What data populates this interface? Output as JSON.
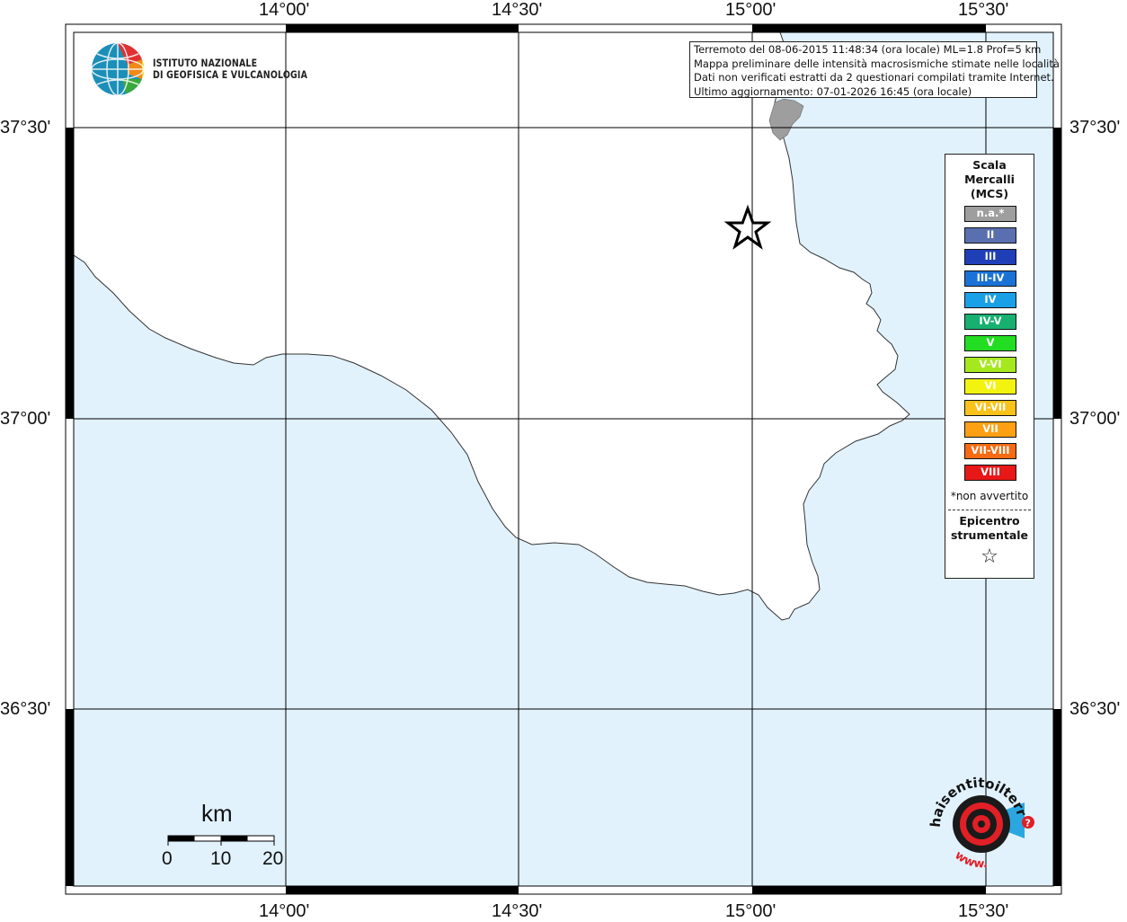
{
  "colors": {
    "sea": "#e1f2fd",
    "land": "#ffffff",
    "urban": "#9e9e9e",
    "frame": "#000000"
  },
  "axes": {
    "top_longitudes": [
      "14°00'",
      "14°30'",
      "15°00'",
      "15°30'"
    ],
    "bottom_longitudes": [
      "14°00'",
      "14°30'",
      "15°00'",
      "15°30'"
    ],
    "left_latitudes": [
      "37°30'",
      "37°00'",
      "36°30'"
    ],
    "right_latitudes": [
      "37°30'",
      "37°00'",
      "36°30'"
    ]
  },
  "header": {
    "org_line1": "ISTITUTO NAZIONALE",
    "org_line2": "DI GEOFISICA E VULCANOLOGIA",
    "logo_icon": "ingv-globe-logo-icon"
  },
  "info": {
    "line1": "Terremoto del 08-06-2015 11:48:34 (ora locale) ML=1.8 Prof=5 km",
    "line2": "Mappa preliminare delle intensità macrosismiche stimate nelle località",
    "line3": "Dati non verificati estratti da 2 questionari compilati tramite Internet.",
    "line4": "Ultimo aggiornamento: 07-01-2026 16:45 (ora locale)"
  },
  "legend": {
    "title_line1": "Scala",
    "title_line2": "Mercalli",
    "title_line3": "(MCS)",
    "items": [
      {
        "label": "n.a.*",
        "color": "#9e9e9e"
      },
      {
        "label": "II",
        "color": "#5a6fb0"
      },
      {
        "label": "III",
        "color": "#1f3fb8"
      },
      {
        "label": "III-IV",
        "color": "#1a72d6"
      },
      {
        "label": "IV",
        "color": "#1aa0e6"
      },
      {
        "label": "IV-V",
        "color": "#17b070"
      },
      {
        "label": "V",
        "color": "#22dd22"
      },
      {
        "label": "V-VI",
        "color": "#a6e81e"
      },
      {
        "label": "VI",
        "color": "#f3f310"
      },
      {
        "label": "VI-VII",
        "color": "#f8c21a"
      },
      {
        "label": "VII",
        "color": "#fda014"
      },
      {
        "label": "VII-VIII",
        "color": "#f56a12"
      },
      {
        "label": "VIII",
        "color": "#e81818"
      }
    ],
    "footnote": "*non avvertito",
    "epicenter_line1": "Epicentro",
    "epicenter_line2": "strumentale",
    "epicenter_symbol": "☆"
  },
  "scalebar": {
    "unit": "km",
    "labels": [
      "0",
      "10",
      "20"
    ]
  },
  "badge": {
    "text": "haisentitoilterremoto.it",
    "prefix": "www.",
    "question": "?"
  }
}
